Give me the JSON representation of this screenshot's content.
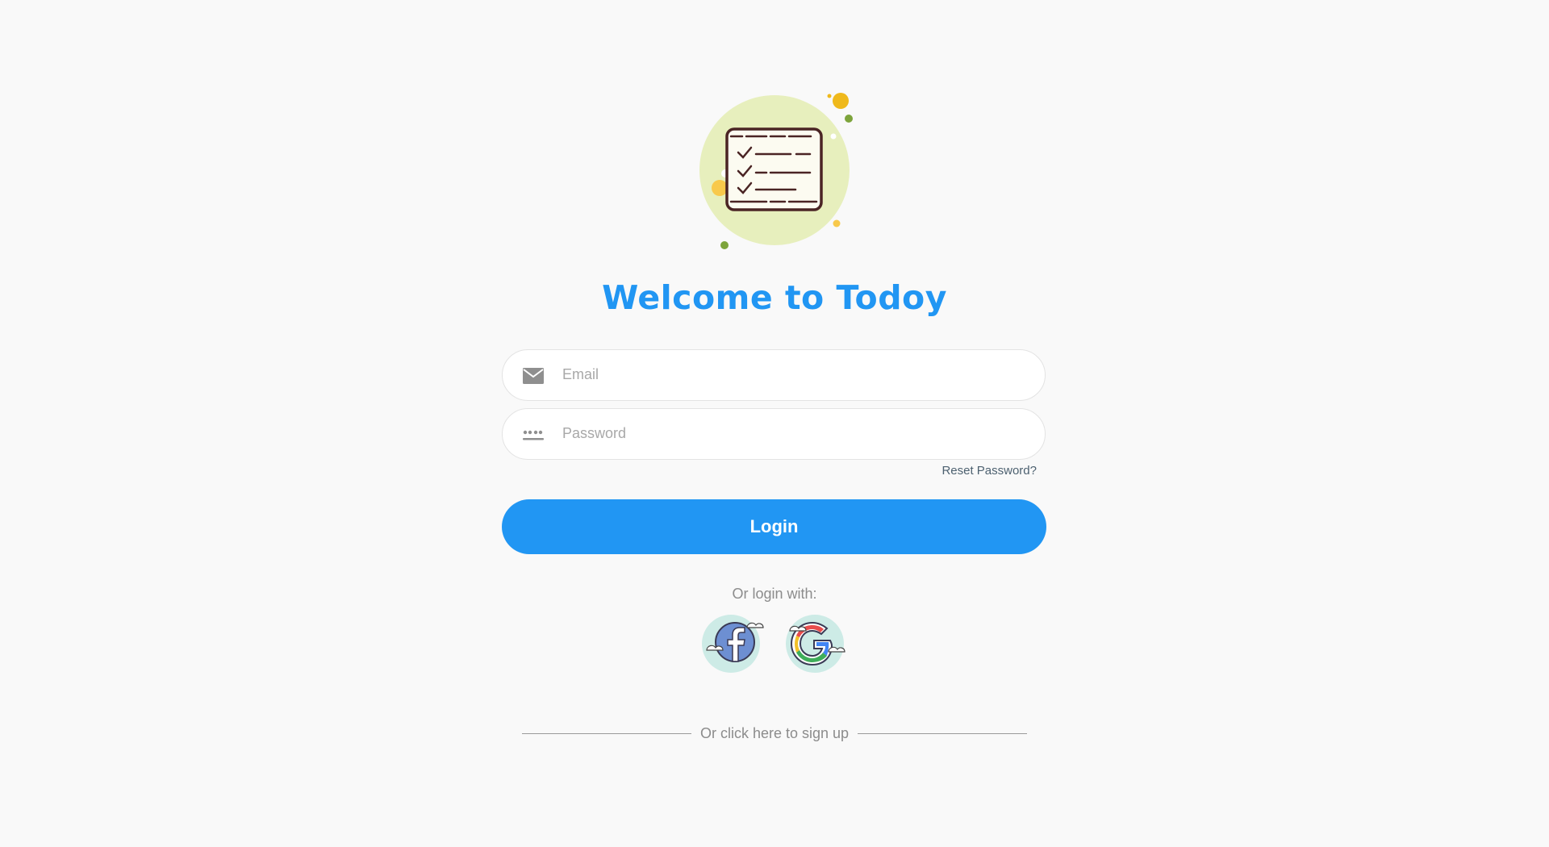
{
  "header": {
    "title": "Welcome to Todoy",
    "logo_icon": "checklist-icon"
  },
  "form": {
    "email": {
      "placeholder": "Email",
      "value": "",
      "icon": "envelope-icon"
    },
    "password": {
      "placeholder": "Password",
      "value": "",
      "icon": "password-dots-icon"
    },
    "reset_label": "Reset Password?",
    "login_label": "Login"
  },
  "social": {
    "label": "Or login with:",
    "providers": [
      {
        "name": "Facebook",
        "icon": "facebook-icon"
      },
      {
        "name": "Google",
        "icon": "google-icon"
      }
    ]
  },
  "signup": {
    "label": "Or click here to sign up"
  },
  "colors": {
    "accent": "#2196f3",
    "background": "#f9f9f9",
    "logo_circle": "#e7efbd"
  }
}
